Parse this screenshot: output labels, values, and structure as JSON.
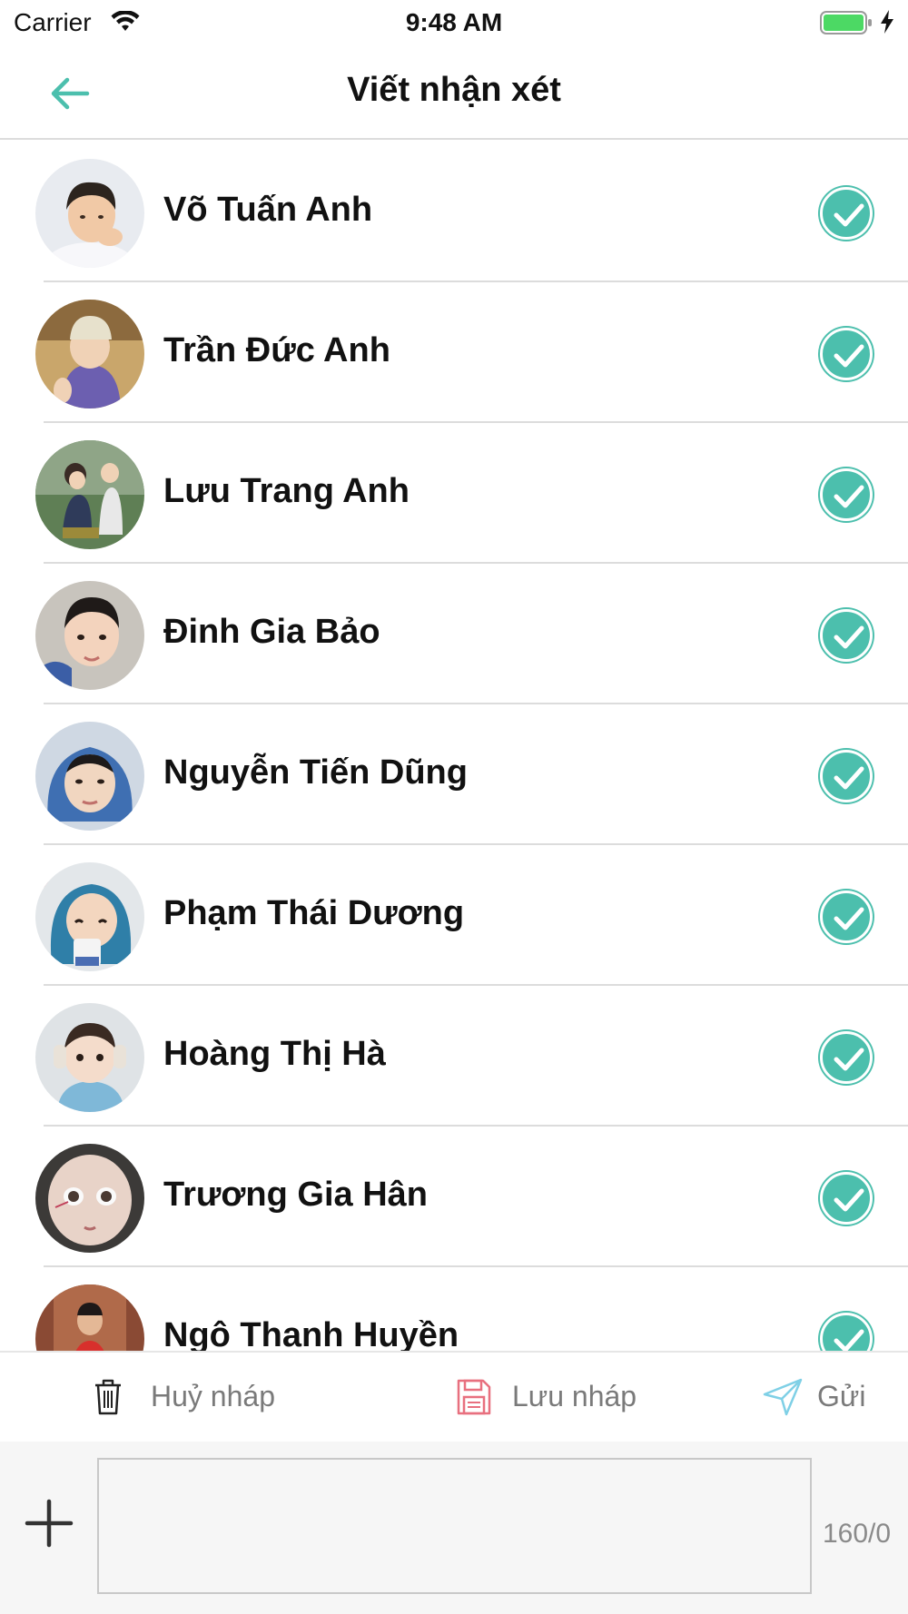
{
  "status_bar": {
    "carrier": "Carrier",
    "time": "9:48 AM"
  },
  "nav": {
    "title": "Viết nhận xét"
  },
  "students": [
    {
      "name": "Võ Tuấn Anh",
      "checked": true
    },
    {
      "name": "Trần Đức Anh",
      "checked": true
    },
    {
      "name": "Lưu Trang Anh",
      "checked": true
    },
    {
      "name": "Đinh Gia Bảo",
      "checked": true
    },
    {
      "name": "Nguyễn Tiến Dũng",
      "checked": true
    },
    {
      "name": "Phạm Thái Dương",
      "checked": true
    },
    {
      "name": "Hoàng Thị Hà",
      "checked": true
    },
    {
      "name": "Trương Gia Hân",
      "checked": true
    },
    {
      "name": "Ngô Thanh Huyền",
      "checked": true
    }
  ],
  "actions": {
    "cancel_draft": "Huỷ nháp",
    "save_draft": "Lưu nháp",
    "send": "Gửi"
  },
  "compose": {
    "value": "",
    "placeholder": "",
    "char_count": "160/0"
  },
  "colors": {
    "accent": "#4cbfad",
    "save_icon": "#e8707f",
    "send_icon": "#7fd0e6",
    "battery": "#4cd964"
  },
  "icons": {
    "back": "arrow-left-icon",
    "check": "check-circle-icon",
    "cancel": "trash-icon",
    "save": "floppy-disk-icon",
    "send": "paper-plane-icon",
    "add": "plus-icon"
  }
}
